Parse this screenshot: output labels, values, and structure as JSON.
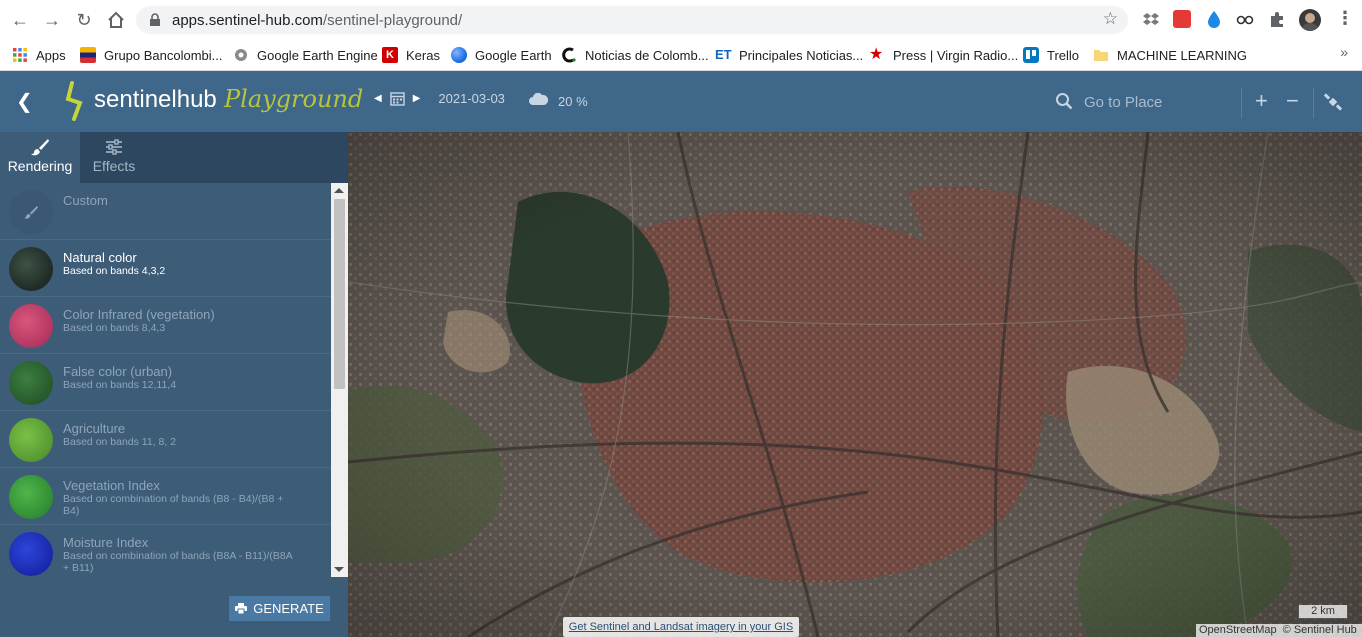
{
  "browser": {
    "url_host": "apps.sentinel-hub.com",
    "url_path": "/sentinel-playground/",
    "bookmarks": [
      {
        "label": "Apps",
        "icon": "apps-grid-icon",
        "color": "#4285f4"
      },
      {
        "label": "Grupo Bancolombi...",
        "icon": "bancolombia-icon",
        "color": "#f4b400"
      },
      {
        "label": "Google Earth Engine",
        "icon": "earth-engine-icon",
        "color": "#8a8a8a"
      },
      {
        "label": "Keras",
        "icon": "keras-icon",
        "color": "#d00000"
      },
      {
        "label": "Google Earth",
        "icon": "google-earth-icon",
        "color": "#1a73e8"
      },
      {
        "label": "Noticias de Colomb...",
        "icon": "colombia-news-icon",
        "color": "#111111"
      },
      {
        "label": "Principales Noticias...",
        "icon": "et-icon",
        "color": "#1565c0"
      },
      {
        "label": "Press | Virgin Radio...",
        "icon": "star-red-icon",
        "color": "#d50000"
      },
      {
        "label": "Trello",
        "icon": "trello-icon",
        "color": "#0079bf"
      },
      {
        "label": "MACHINE LEARNING",
        "icon": "folder-icon",
        "color": "#f7d774"
      }
    ],
    "more_bookmarks": "»"
  },
  "header": {
    "logo_text": "sentinelhub",
    "logo_subtitle": "Playground",
    "date": "2021-03-03",
    "cloud_coverage": "20 %",
    "search_placeholder": "Go to Place",
    "zoom_in": "+",
    "zoom_out": "−"
  },
  "sidebar": {
    "tabs": [
      {
        "label": "Rendering",
        "active": true
      },
      {
        "label": "Effects",
        "active": false
      }
    ],
    "presets": [
      {
        "title": "Custom",
        "subtitle": "",
        "color": "#3d5c78",
        "selected": false
      },
      {
        "title": "Natural color",
        "subtitle": "Based on bands 4,3,2",
        "color": "#2c3b34",
        "selected": true
      },
      {
        "title": "Color Infrared (vegetation)",
        "subtitle": "Based on bands 8,4,3",
        "color": "#c2416a",
        "selected": false
      },
      {
        "title": "False color (urban)",
        "subtitle": "Based on bands 12,11,4",
        "color": "#2f6a33",
        "selected": false
      },
      {
        "title": "Agriculture",
        "subtitle": "Based on bands 11, 8, 2",
        "color": "#63a83a",
        "selected": false
      },
      {
        "title": "Vegetation Index",
        "subtitle": "Based on combination of bands (B8 - B4)/(B8 + B4)",
        "color": "#3f9e3d",
        "selected": false
      },
      {
        "title": "Moisture Index",
        "subtitle": "Based on combination of bands (B8A - B11)/(B8A + B11)",
        "color": "#1e34c4",
        "selected": false
      }
    ],
    "generate_label": "GENERATE"
  },
  "map": {
    "promo_link": "Get Sentinel and Landsat imagery in your GIS",
    "scale": "2 km",
    "attribution_osm": "OpenStreetMap",
    "attribution_sh": "© Sentinel Hub"
  }
}
